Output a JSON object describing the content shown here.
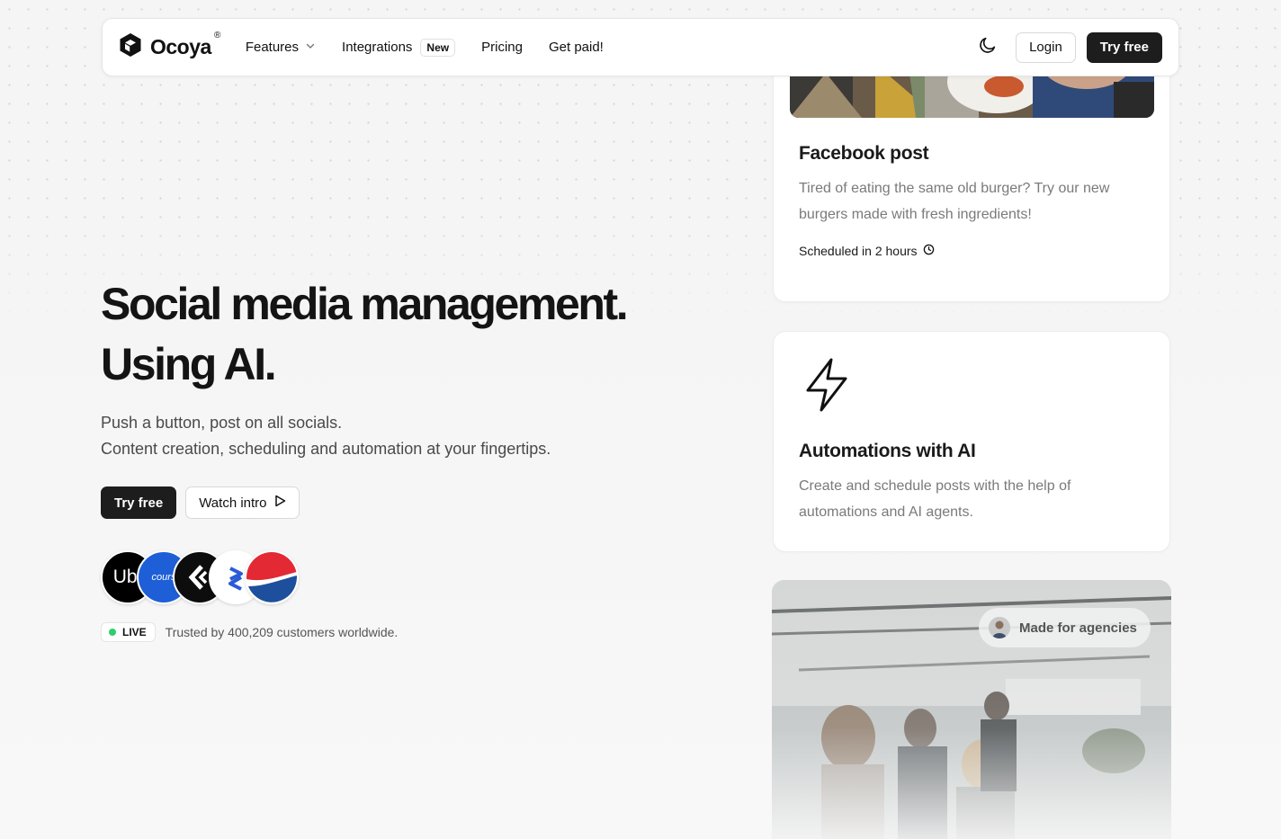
{
  "nav": {
    "brand": "Ocoya",
    "brand_reg": "®",
    "links": [
      {
        "label": "Features"
      },
      {
        "label": "Integrations",
        "badge": "New"
      },
      {
        "label": "Pricing"
      },
      {
        "label": "Get paid!"
      }
    ],
    "login_label": "Login",
    "try_free_label": "Try free"
  },
  "hero": {
    "title_line1": "Social media management.",
    "title_line2": "Using AI.",
    "subtitle_line1": "Push a button, post on all socials.",
    "subtitle_line2": "Content creation, scheduling and automation at your fingertips.",
    "try_free_label": "Try free",
    "watch_intro_label": "Watch intro",
    "logos": [
      "uber-logo",
      "coursera-logo",
      "codecademy-logo",
      "pipedrive-logo",
      "pepsi-logo"
    ],
    "logo_uber_text": "Ube",
    "logo_coursera_text": "course",
    "live_label": "LIVE",
    "trust_text": "Trusted by 400,209 customers worldwide."
  },
  "cards": {
    "facebook": {
      "title": "Facebook post",
      "text": "Tired of eating the same old burger? Try our new burgers made with fresh ingredients!",
      "scheduled": "Scheduled in 2 hours"
    },
    "automations": {
      "title": "Automations with AI",
      "text": "Create and schedule posts with the help of automations and AI agents."
    },
    "agencies": {
      "pill_label": "Made for agencies"
    }
  },
  "colors": {
    "dark_button": "#1d1d1d",
    "live_dot": "#2dcf6c",
    "page_bg": "#f5f5f5"
  }
}
